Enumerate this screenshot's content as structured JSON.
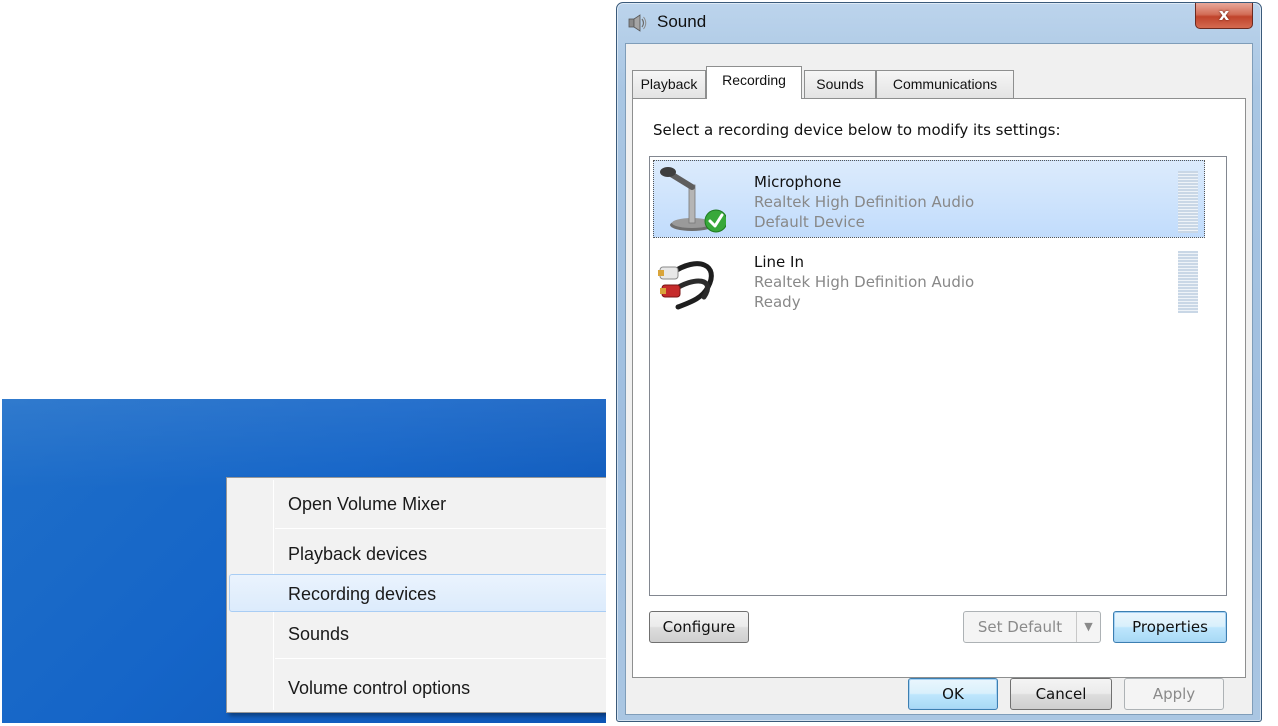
{
  "context_menu": {
    "items": [
      {
        "label": "Open Volume Mixer"
      },
      {
        "label": "Playback devices"
      },
      {
        "label": "Recording devices",
        "highlighted": true
      },
      {
        "label": "Sounds"
      },
      {
        "label": "Volume control options"
      }
    ]
  },
  "dialog": {
    "title": "Sound",
    "close_label": "x",
    "tabs": [
      {
        "label": "Playback"
      },
      {
        "label": "Recording",
        "active": true
      },
      {
        "label": "Sounds"
      },
      {
        "label": "Communications"
      }
    ],
    "instruction": "Select a recording device below to modify its settings:",
    "devices": [
      {
        "name": "Microphone",
        "driver": "Realtek High Definition Audio",
        "status": "Default Device",
        "selected": true,
        "icon": "microphone-icon"
      },
      {
        "name": "Line In",
        "driver": "Realtek High Definition Audio",
        "status": "Ready",
        "icon": "line-in-icon"
      }
    ],
    "buttons": {
      "configure": "Configure",
      "set_default": "Set Default",
      "properties": "Properties",
      "ok": "OK",
      "cancel": "Cancel",
      "apply": "Apply"
    }
  },
  "colors": {
    "desktop": "#1565c8",
    "selection": "#c1dcfc",
    "close_button": "#c0442c"
  }
}
